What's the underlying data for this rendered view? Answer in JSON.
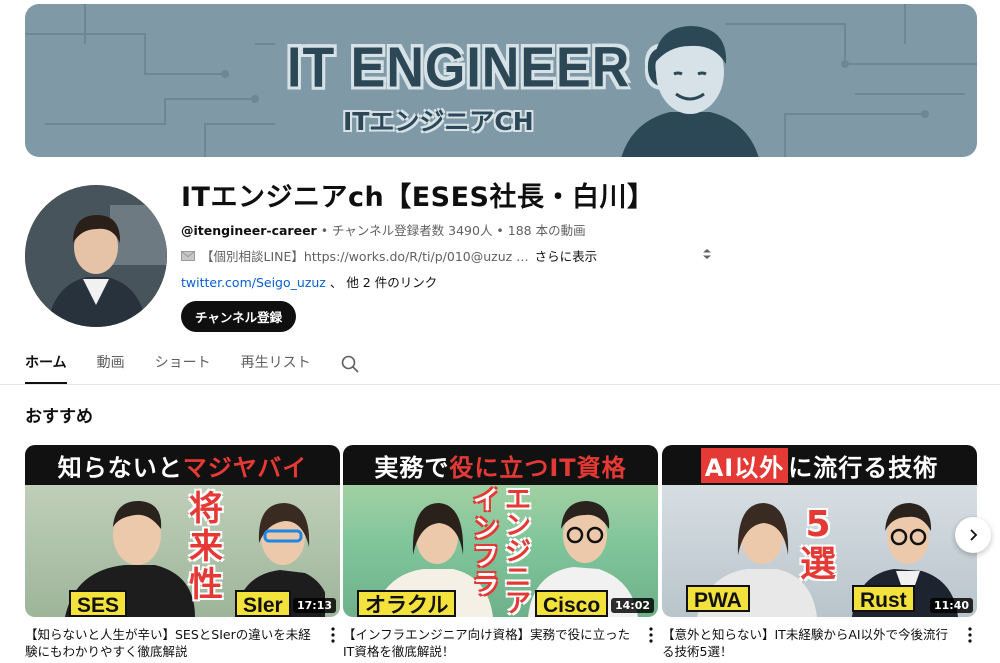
{
  "banner": {
    "title": "IT ENGINEER CH",
    "subtitle": "ITエンジニアCH"
  },
  "channel": {
    "name": "ITエンジニアch【ESES社長・白川】",
    "handle": "@itengineer-career",
    "stats": " • チャンネル登録者数 3490人 • 188 本の動画",
    "description": "【個別相談LINE】https://works.do/R/ti/p/010@uzuz …",
    "more": "さらに表示",
    "link": "twitter.com/Seigo_uzuz",
    "other_links": "、 他 2 件のリンク",
    "subscribe_label": "チャンネル登録"
  },
  "tabs": [
    {
      "label": "ホーム",
      "active": true
    },
    {
      "label": "動画",
      "active": false
    },
    {
      "label": "ショート",
      "active": false
    },
    {
      "label": "再生リスト",
      "active": false
    }
  ],
  "section": {
    "title": "おすすめ"
  },
  "videos": [
    {
      "thumb_banner_a": "知らないと",
      "thumb_banner_b": "マジヤバイ",
      "thumb_side": "将来性",
      "tag_left": "SES",
      "tag_right": "SIer",
      "duration": "17:13",
      "title": "【知らないと人生が辛い】SESとSIerの違いを未経験にもわかりやすく徹底解説"
    },
    {
      "thumb_banner_a": "実務で",
      "thumb_banner_b": "役に立つIT資格",
      "thumb_side_a": "インフラ",
      "thumb_side_b": "エンジニア",
      "tag_left": "オラクル",
      "tag_right": "Cisco",
      "duration": "14:02",
      "title": "【インフラエンジニア向け資格】実務で役に立ったIT資格を徹底解説！"
    },
    {
      "thumb_banner_a": "AI以外",
      "thumb_banner_b": "に流行る技術",
      "thumb_side": "5選",
      "tag_left": "PWA",
      "tag_right": "Rust",
      "duration": "11:40",
      "title": "【意外と知らない】IT未経験からAI以外で今後流行る技術5選！"
    }
  ],
  "colors": {
    "banner_bg": "#7f9aa6",
    "link": "#065fd4",
    "thumb_red": "#e53935",
    "thumb_yellow": "#f4e23c"
  }
}
